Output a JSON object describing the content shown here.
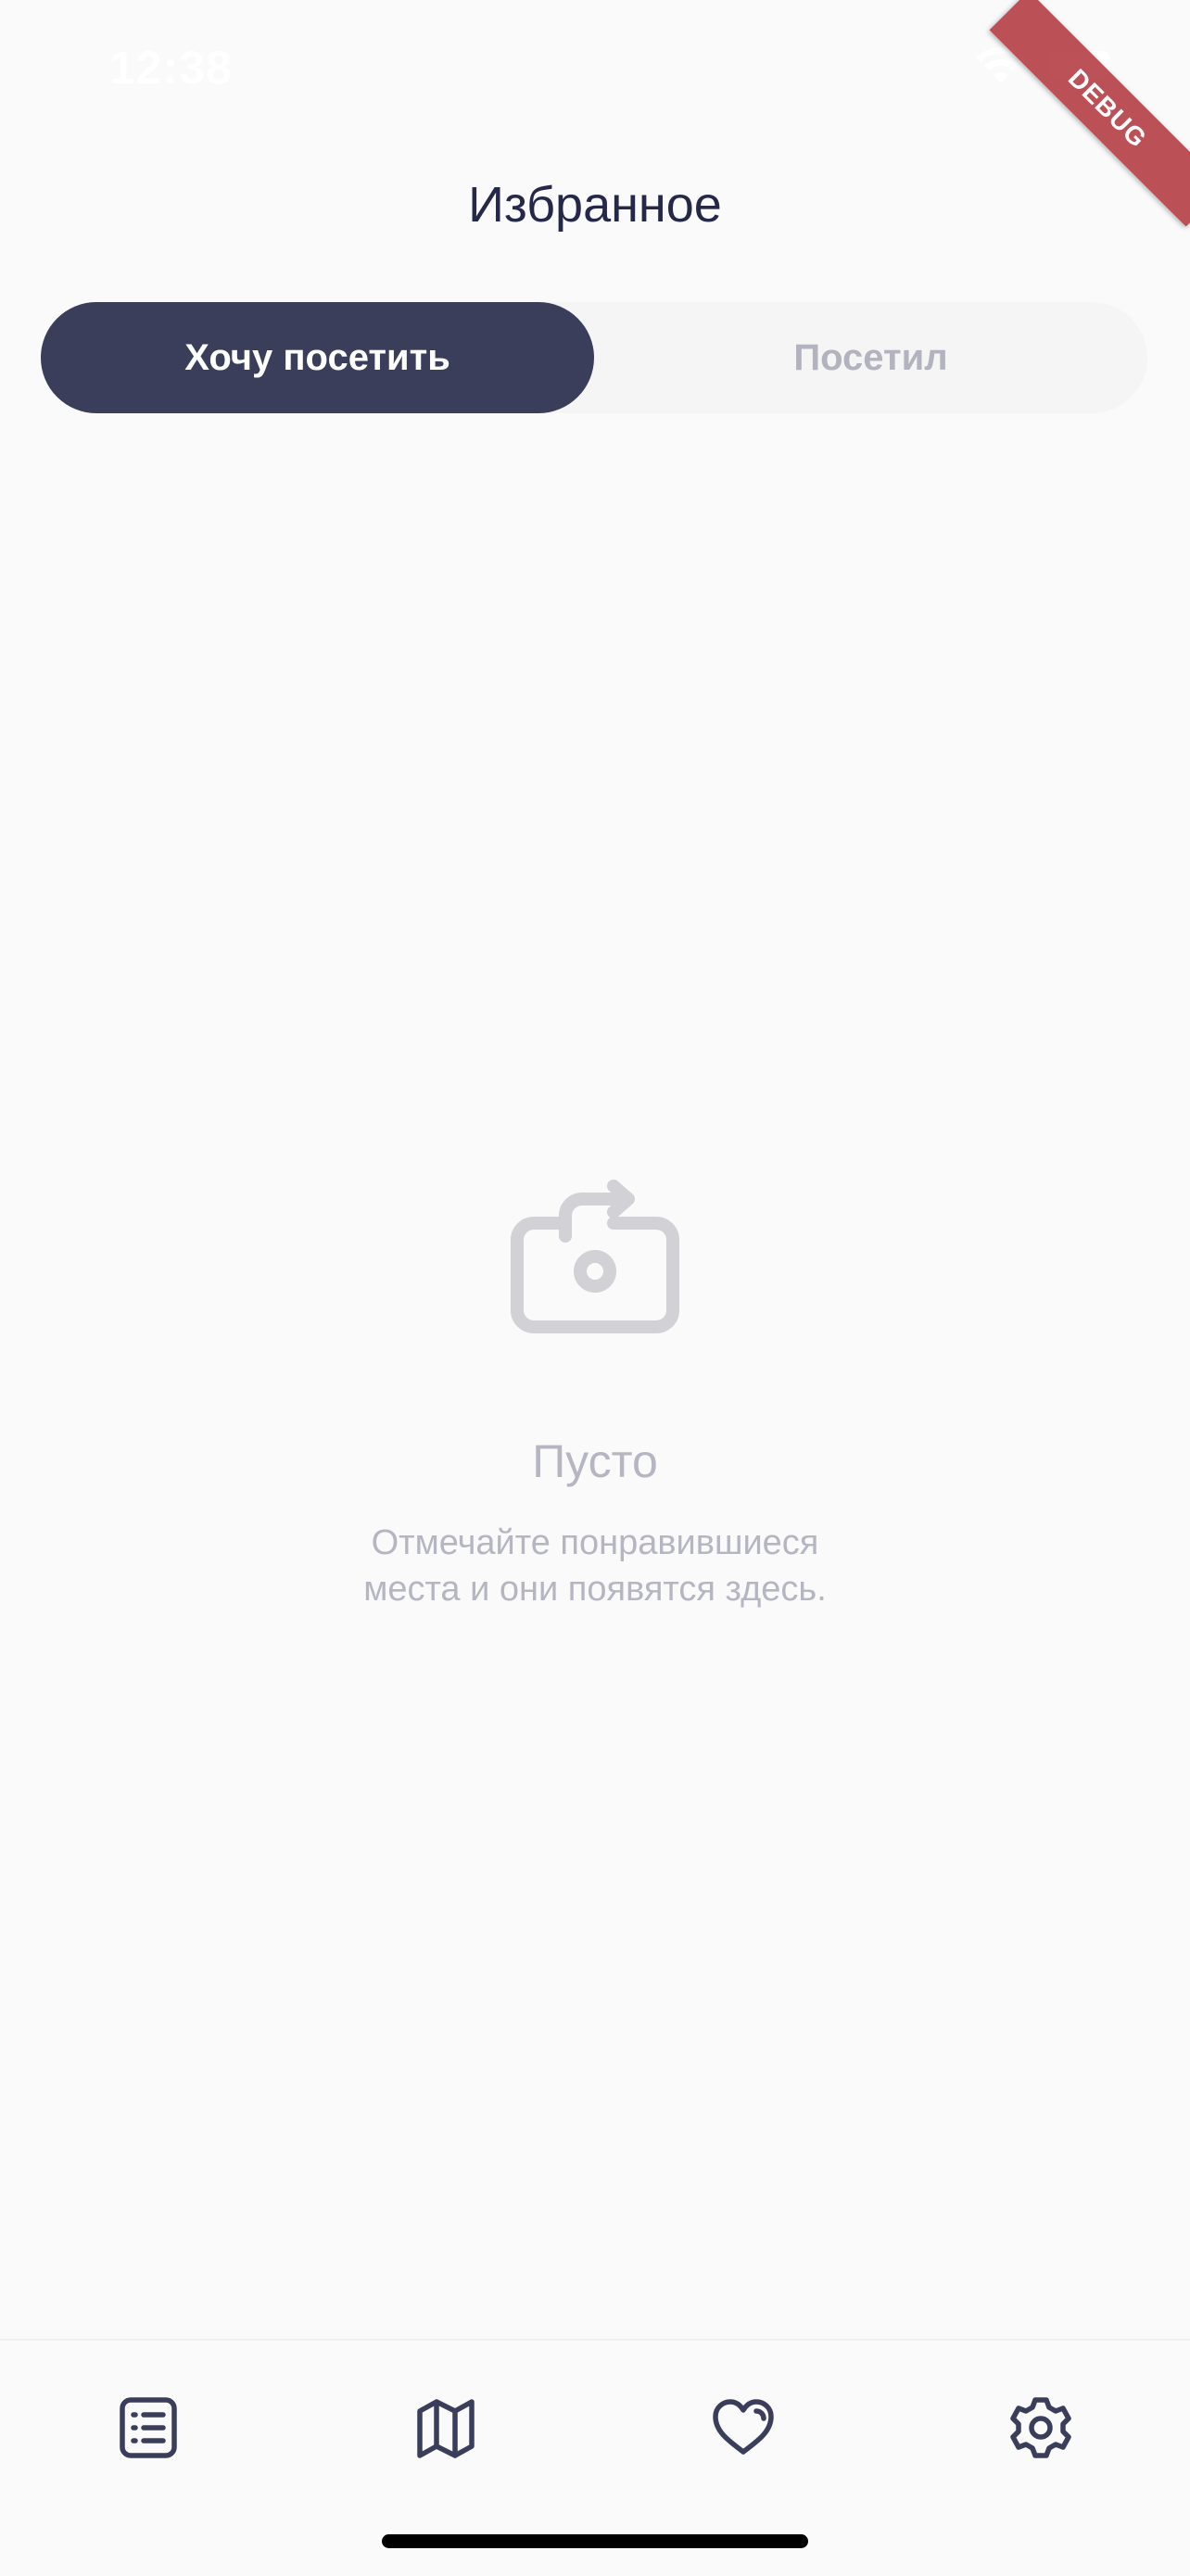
{
  "status_bar": {
    "time": "12:38",
    "icons": [
      "wifi-icon",
      "battery-icon"
    ]
  },
  "debug_banner": "DEBUG",
  "header": {
    "title": "Избранное"
  },
  "tabs": [
    {
      "label": "Хочу посетить",
      "selected": true
    },
    {
      "label": "Посетил",
      "selected": false
    }
  ],
  "empty_state": {
    "icon": "camera-rotate-icon",
    "title": "Пусто",
    "description_line1": "Отмечайте понравившиеся",
    "description_line2": "места и они появятся здесь."
  },
  "bottom_nav": {
    "items": [
      {
        "icon": "list-icon",
        "active": false
      },
      {
        "icon": "map-icon",
        "active": false
      },
      {
        "icon": "heart-icon",
        "active": true
      },
      {
        "icon": "settings-icon",
        "active": false
      }
    ]
  },
  "colors": {
    "background": "#FAFAFA",
    "primary": "#3B3E5B",
    "title_text": "#252849",
    "muted_text": "#B5B6C1",
    "segment_bg": "#F5F5F5",
    "debug_ribbon": "#A61820"
  }
}
